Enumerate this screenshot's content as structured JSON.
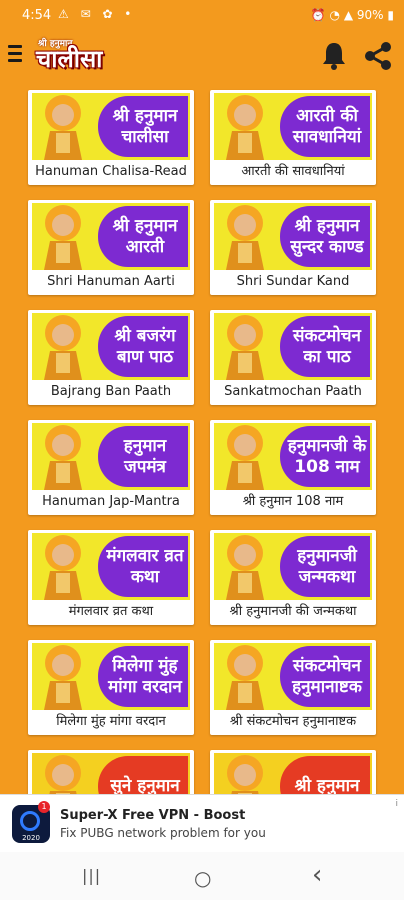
{
  "status": {
    "time": "4:54",
    "left_icons": "⚠ ✉ ✿ •",
    "battery": "90%"
  },
  "appbar": {
    "logo_small": "श्री हनुमान",
    "logo_big": "चालीसा"
  },
  "cards": [
    {
      "banner": "श्री हनुमान चालीसा",
      "caption": "Hanuman Chalisa-Read"
    },
    {
      "banner": "आरती की सावधानियां",
      "caption": "आरती की सावधानियां"
    },
    {
      "banner": "श्री हनुमान आरती",
      "caption": "Shri Hanuman Aarti"
    },
    {
      "banner": "श्री हनुमान सुन्दर काण्ड",
      "caption": "Shri Sundar Kand"
    },
    {
      "banner": "श्री बजरंग बाण पाठ",
      "caption": "Bajrang Ban Paath"
    },
    {
      "banner": "संकटमोचन का पाठ",
      "caption": "Sankatmochan Paath"
    },
    {
      "banner": "हनुमान जपमंत्र",
      "caption": "Hanuman Jap-Mantra"
    },
    {
      "banner": "हनुमानजी के 108 नाम",
      "caption": "श्री हनुमान 108 नाम"
    },
    {
      "banner": "मंगलवार व्रत कथा",
      "caption": "मंगलवार व्रत कथा"
    },
    {
      "banner": "हनुमानजी जन्मकथा",
      "caption": "श्री हनुमानजी की जन्मकथा"
    },
    {
      "banner": "मिलेगा मुंह मांगा वरदान",
      "caption": "मिलेगा मुंह मांगा वरदान"
    },
    {
      "banner": "संकटमोचन हनुमानाष्टक",
      "caption": "श्री संकटमोचन हनुमानाष्टक"
    },
    {
      "banner": "सुने हनुमान",
      "caption": ""
    },
    {
      "banner": "श्री हनुमान",
      "caption": ""
    }
  ],
  "ad": {
    "title": "Super-X Free VPN - Boost",
    "subtitle": "Fix PUBG network problem for you",
    "icon_label": "2020",
    "badge": "1",
    "info": "i"
  },
  "nav": {
    "recents": "|||",
    "home": "○",
    "back": "‹"
  },
  "colors": {
    "background": "#f39a1e",
    "panel_purple": "#7d2ad1",
    "panel_red": "#e53b23",
    "banner_yellow": "#f2e72a"
  }
}
